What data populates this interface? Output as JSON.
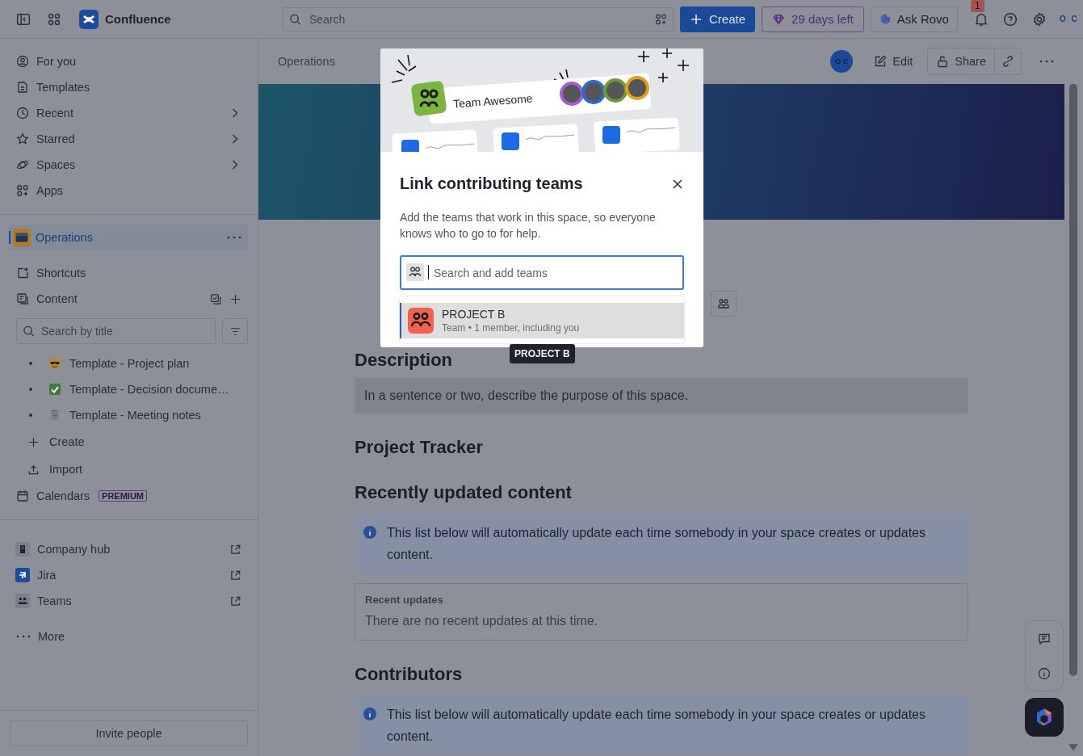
{
  "topbar": {
    "product": "Confluence",
    "search": {
      "placeholder": "Search"
    },
    "create": "Create",
    "trial": "29 days left",
    "ask": "Ask Rovo",
    "notifications": "1",
    "avatar": "O C"
  },
  "sidebar": {
    "nav": [
      {
        "label": "For you",
        "expandable": false
      },
      {
        "label": "Templates",
        "expandable": false
      },
      {
        "label": "Recent",
        "expandable": true
      },
      {
        "label": "Starred",
        "expandable": true
      },
      {
        "label": "Spaces",
        "expandable": true
      },
      {
        "label": "Apps",
        "expandable": false
      }
    ],
    "space": {
      "name": "Operations",
      "selected": true
    },
    "space_items": [
      {
        "label": "Shortcuts"
      },
      {
        "label": "Content"
      }
    ],
    "content_search": {
      "placeholder": "Search by title"
    },
    "pages": [
      {
        "title": "Template - Project plan"
      },
      {
        "title": "Template - Decision docume…"
      },
      {
        "title": "Template - Meeting notes"
      }
    ],
    "actions": [
      {
        "label": "Create"
      },
      {
        "label": "Import"
      }
    ],
    "calendars": {
      "label": "Calendars",
      "badge": "PREMIUM"
    },
    "links": [
      {
        "label": "Company hub"
      },
      {
        "label": "Jira"
      },
      {
        "label": "Teams"
      }
    ],
    "more": "More",
    "invite": "Invite people"
  },
  "header": {
    "breadcrumb": "Operations",
    "avatar": "O C",
    "edit": "Edit",
    "share": "Share"
  },
  "modal": {
    "illustration_label": "Team Awesome",
    "title": "Link contributing teams",
    "description": "Add the teams that work in this space, so everyone knows who to go to for help.",
    "search": {
      "placeholder": "Search and add teams"
    },
    "results": [
      {
        "name": "PROJECT B",
        "meta": "Team • 1 member, including you",
        "selected": true
      }
    ],
    "tooltip": "PROJECT B"
  },
  "content": [
    {
      "kind": "heading",
      "text": "Description"
    },
    {
      "kind": "placeholder",
      "text": "In a sentence or two, describe the purpose of this space."
    },
    {
      "kind": "heading",
      "text": "Project Tracker"
    },
    {
      "kind": "heading",
      "text": "Recently updated content"
    },
    {
      "kind": "info",
      "text": "This list below will automatically update each time somebody in your space creates or updates content."
    },
    {
      "kind": "card",
      "title": "Recent updates",
      "text": "There are no recent updates at this time."
    },
    {
      "kind": "heading",
      "text": "Contributors"
    },
    {
      "kind": "info",
      "text": "This list below will automatically update each time somebody in your space creates or updates content."
    }
  ]
}
